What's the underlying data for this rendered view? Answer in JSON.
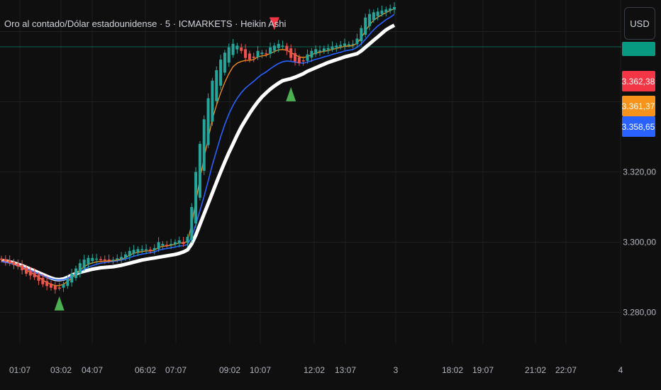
{
  "header": {
    "title": "Oro al contado/Dólar estadounidense · 5 · ICMARKETS · Heikin Ashi",
    "currency_button": "USD"
  },
  "colors": {
    "background": "#0f0f0f",
    "grid": "#1e1e1e",
    "candle_up": "#26a69a",
    "candle_down": "#ef5350",
    "ema_fast": "#f7931a",
    "ema_mid": "#2962ff",
    "ema_slow": "#ffffff",
    "marker_buy": "#4caf50",
    "marker_sell": "#f23645",
    "tag_last": "#089981",
    "tag_red": "#f23645",
    "tag_orange": "#f7931a",
    "tag_blue": "#2962ff"
  },
  "chart_data": {
    "type": "candlestick",
    "title": "Oro al contado/Dólar estadounidense · 5 · ICMARKETS · Heikin Ashi",
    "y_ticks": [
      "3.280,00",
      "3.300,00",
      "3.320,00"
    ],
    "x_ticks": [
      "01:07",
      "03:02",
      "04:07",
      "06:02",
      "07:07",
      "09:02",
      "10:07",
      "12:02",
      "13:07",
      "3",
      "18:02",
      "19:07",
      "21:02",
      "22:07",
      "4"
    ],
    "ylim": [
      3271,
      3369
    ],
    "price_tags": [
      {
        "value": 3362.38,
        "label": "3.362,38",
        "role": "candle"
      },
      {
        "value": 3361.37,
        "label": "3.361,37",
        "role": "ema_fast"
      },
      {
        "value": 3358.65,
        "label": "3.358,65",
        "role": "ema_mid"
      }
    ],
    "series_close": [
      3295,
      3294.5,
      3294,
      3293.5,
      3293,
      3292,
      3291,
      3290.5,
      3290,
      3289,
      3288,
      3287.5,
      3287,
      3286.5,
      3287,
      3288,
      3289.5,
      3291,
      3292.5,
      3294,
      3295,
      3295.5,
      3295.5,
      3295.3,
      3295,
      3295,
      3294.8,
      3295,
      3295.4,
      3295.8,
      3296.5,
      3297.5,
      3297.8,
      3298,
      3298,
      3298,
      3297.5,
      3298.3,
      3300,
      3299.5,
      3299.2,
      3299.5,
      3300,
      3300.5,
      3299.5,
      3301.5,
      3310,
      3320,
      3328,
      3335,
      3341,
      3346,
      3349,
      3352,
      3354,
      3355.5,
      3356.5,
      3356,
      3354.5,
      3352.5,
      3352,
      3352.5,
      3354.5,
      3354,
      3353.5,
      3355.5,
      3356,
      3356.5,
      3356,
      3354.5,
      3352.5,
      3351.5,
      3351,
      3351.5,
      3353.5,
      3354.5,
      3355,
      3354.6,
      3355.2,
      3355.3,
      3355.8,
      3356,
      3356.2,
      3356.6,
      3356.4,
      3356.5,
      3358,
      3361,
      3364,
      3365,
      3365.5,
      3365.7,
      3366,
      3366.3,
      3366.6,
      3367
    ],
    "ema_fast": [
      3295,
      3294.8,
      3294.5,
      3294,
      3293.5,
      3292.8,
      3292,
      3291.4,
      3290.8,
      3290,
      3289.2,
      3288.5,
      3288,
      3287.6,
      3287.6,
      3288,
      3288.8,
      3289.8,
      3290.9,
      3292,
      3293,
      3293.7,
      3294.1,
      3294.4,
      3294.5,
      3294.6,
      3294.6,
      3294.7,
      3294.9,
      3295.1,
      3295.6,
      3296.3,
      3296.8,
      3297.1,
      3297.3,
      3297.5,
      3297.5,
      3297.7,
      3298.5,
      3298.8,
      3298.9,
      3299.1,
      3299.4,
      3299.8,
      3299.7,
      3300.3,
      3305,
      3311.5,
      3318,
      3324,
      3329.5,
      3335,
      3339,
      3342.5,
      3345.5,
      3348,
      3350,
      3351,
      3351.5,
      3351.8,
      3351.8,
      3352,
      3352.8,
      3353.1,
      3353.2,
      3353.8,
      3354.3,
      3354.8,
      3354.9,
      3354.7,
      3354,
      3353.4,
      3352.8,
      3352.6,
      3352.9,
      3353.4,
      3353.9,
      3354.1,
      3354.4,
      3354.6,
      3354.9,
      3355.2,
      3355.5,
      3355.8,
      3355.9,
      3356,
      3356.7,
      3358.2,
      3360.2,
      3361.9,
      3363.2,
      3364.1,
      3364.8,
      3365.4,
      3366,
      3366.5
    ],
    "ema_mid": [
      3294.5,
      3294.3,
      3294.1,
      3293.8,
      3293.5,
      3293,
      3292.5,
      3292,
      3291.5,
      3291,
      3290.5,
      3290,
      3289.6,
      3289.3,
      3289.2,
      3289.3,
      3289.7,
      3290.3,
      3290.9,
      3291.6,
      3292.3,
      3292.9,
      3293.3,
      3293.7,
      3294,
      3294.2,
      3294.4,
      3294.5,
      3294.7,
      3294.9,
      3295.2,
      3295.6,
      3296,
      3296.3,
      3296.6,
      3296.8,
      3297,
      3297.2,
      3297.7,
      3298,
      3298.2,
      3298.4,
      3298.6,
      3298.9,
      3299,
      3299.3,
      3301.5,
      3305,
      3309,
      3313,
      3317.5,
      3322,
      3326,
      3330,
      3333.5,
      3336.5,
      3339,
      3341,
      3342.6,
      3343.9,
      3344.9,
      3345.8,
      3346.9,
      3347.8,
      3348.5,
      3349.4,
      3350.2,
      3350.9,
      3351.4,
      3351.6,
      3351.5,
      3351.3,
      3351.1,
      3351,
      3351.3,
      3351.7,
      3352.1,
      3352.4,
      3352.8,
      3353.1,
      3353.5,
      3353.8,
      3354.1,
      3354.5,
      3354.7,
      3354.9,
      3355.5,
      3356.5,
      3357.8,
      3359.2,
      3360.5,
      3361.6,
      3362.5,
      3363.4,
      3364.1,
      3364.9
    ],
    "ema_slow": [
      3294.8,
      3294.6,
      3294.4,
      3294.1,
      3293.7,
      3293.3,
      3292.8,
      3292.3,
      3291.8,
      3291.3,
      3290.8,
      3290.3,
      3289.8,
      3289.4,
      3289.3,
      3289.5,
      3290,
      3290.6,
      3291,
      3291.4,
      3291.7,
      3292,
      3292.3,
      3292.5,
      3292.7,
      3292.8,
      3292.9,
      3293,
      3293.2,
      3293.4,
      3293.7,
      3294,
      3294.3,
      3294.6,
      3294.9,
      3295.1,
      3295.3,
      3295.5,
      3295.7,
      3295.9,
      3296.1,
      3296.3,
      3296.5,
      3296.8,
      3297.2,
      3297.8,
      3299.5,
      3302,
      3305,
      3308,
      3311,
      3314,
      3317,
      3320,
      3322.8,
      3325.5,
      3328,
      3330.5,
      3332.8,
      3334.8,
      3336.7,
      3338.4,
      3340,
      3341.4,
      3342.5,
      3343.6,
      3344.5,
      3345.3,
      3346,
      3346.3,
      3346.6,
      3347,
      3347.5,
      3348,
      3348.7,
      3349.2,
      3349.7,
      3350.2,
      3350.7,
      3351.2,
      3351.6,
      3352,
      3352.4,
      3352.8,
      3353.1,
      3353.4,
      3353.7,
      3354.5,
      3355.5,
      3356.5,
      3357.5,
      3358.5,
      3359.5,
      3360.5,
      3361.2,
      3361.8
    ],
    "markers": [
      {
        "type": "sell",
        "index": 66
      },
      {
        "type": "buy",
        "index": 70
      },
      {
        "type": "buy",
        "index": 14
      }
    ]
  }
}
